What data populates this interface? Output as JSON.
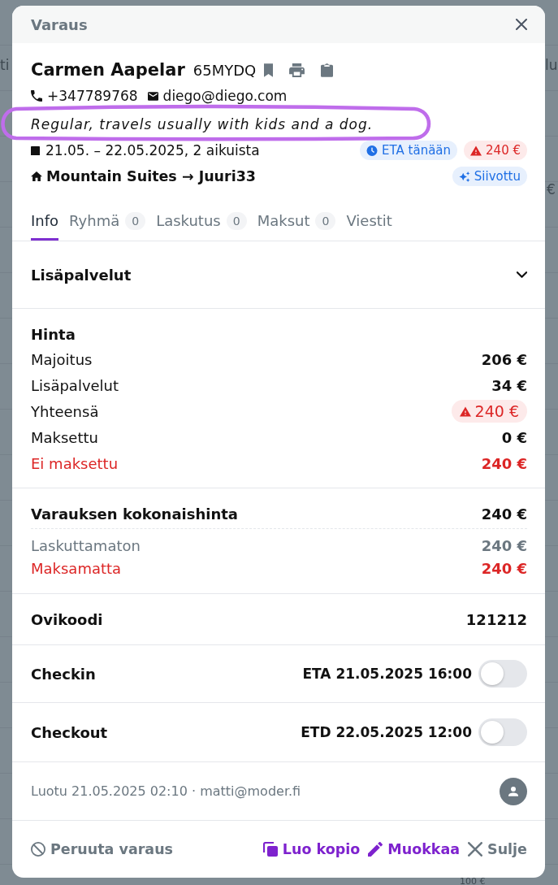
{
  "background_page": {
    "fragments": [
      "ti",
      "lu",
      "€",
      "100 €"
    ]
  },
  "dialog": {
    "title": "Varaus"
  },
  "guest": {
    "name": "Carmen Aapelar",
    "code": "65MYDQ",
    "phone": "+347789768",
    "email": "diego@diego.com",
    "note": "Regular, travels usually with kids and a dog.",
    "dates": "21.05. – 22.05.2025, 2 aikuista",
    "property": "Mountain Suites → Juuri33"
  },
  "date_badges": [
    {
      "label": "ETA tänään",
      "kind": "eta"
    },
    {
      "label": "240 €",
      "kind": "alert"
    }
  ],
  "property_badges": [
    {
      "label": "Siivottu",
      "kind": "cleaned"
    }
  ],
  "tabs": [
    {
      "label": "Info",
      "selected": true
    },
    {
      "label": "Ryhmä",
      "count": "0",
      "selected": false
    },
    {
      "label": "Laskutus",
      "count": "0",
      "selected": false
    },
    {
      "label": "Maksut",
      "count": "0",
      "selected": false
    },
    {
      "label": "Viestit",
      "selected": false
    }
  ],
  "extras_section": {
    "title": "Lisäpalvelut",
    "expanded": false
  },
  "price": {
    "title": "Hinta",
    "rows": [
      {
        "label": "Majoitus",
        "value": "206 €",
        "kind": "plain"
      },
      {
        "label": "Lisäpalvelut",
        "value": "34 €",
        "kind": "plain"
      },
      {
        "label": "Yhteensä",
        "value": "240 €",
        "kind": "alert"
      },
      {
        "label": "Maksettu",
        "value": "0 €",
        "kind": "plain"
      },
      {
        "label": "Ei maksettu",
        "value": "240 €",
        "kind": "due"
      }
    ]
  },
  "total": {
    "label": "Varauksen kokonaishinta",
    "value": "240 €",
    "rows": [
      {
        "label": "Laskuttamaton",
        "value": "240 €",
        "kind": "muted"
      },
      {
        "label": "Maksamatta",
        "value": "240 €",
        "kind": "due"
      }
    ]
  },
  "door_code": {
    "label": "Ovikoodi",
    "value": "121212"
  },
  "checks": [
    {
      "label": "Checkin",
      "time": "ETA 21.05.2025 16:00",
      "on": false
    },
    {
      "label": "Checkout",
      "time": "ETD 22.05.2025 12:00",
      "on": false
    }
  ],
  "created": "Luotu 21.05.2025 02:10 · matti@moder.fi",
  "actions": [
    {
      "label": "Peruuta varaus",
      "kind": "cancel"
    },
    {
      "label": "Luo kopio",
      "kind": "copy"
    },
    {
      "label": "Muokkaa",
      "kind": "edit"
    },
    {
      "label": "Sulje",
      "kind": "close"
    }
  ],
  "annotation": {
    "kind": "ellipse"
  }
}
